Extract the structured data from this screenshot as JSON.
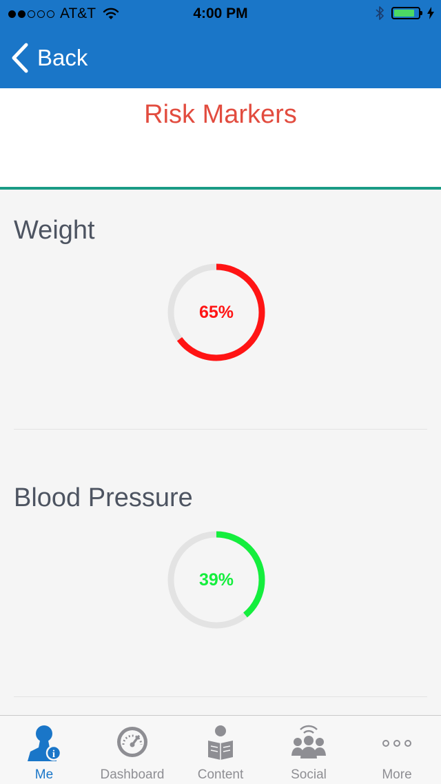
{
  "status_bar": {
    "signal_filled": 2,
    "signal_total": 5,
    "carrier": "AT&T",
    "time": "4:00 PM",
    "battery_level": 0.85,
    "battery_color": "#4cd964"
  },
  "nav": {
    "back_label": "Back",
    "color": "#1a76c8"
  },
  "page": {
    "title": "Risk Markers",
    "title_color": "#e24c3f",
    "accent_rule_color": "#1a9b85"
  },
  "markers": [
    {
      "label": "Weight",
      "percent": 65,
      "percent_text": "65%",
      "color": "#ff1414"
    },
    {
      "label": "Blood Pressure",
      "percent": 39,
      "percent_text": "39%",
      "color": "#14ee3d"
    }
  ],
  "tabs": [
    {
      "label": "Me",
      "icon": "person-info-icon",
      "active": true
    },
    {
      "label": "Dashboard",
      "icon": "gauge-icon",
      "active": false
    },
    {
      "label": "Content",
      "icon": "reader-icon",
      "active": false
    },
    {
      "label": "Social",
      "icon": "group-icon",
      "active": false
    },
    {
      "label": "More",
      "icon": "more-dots-icon",
      "active": false
    }
  ]
}
